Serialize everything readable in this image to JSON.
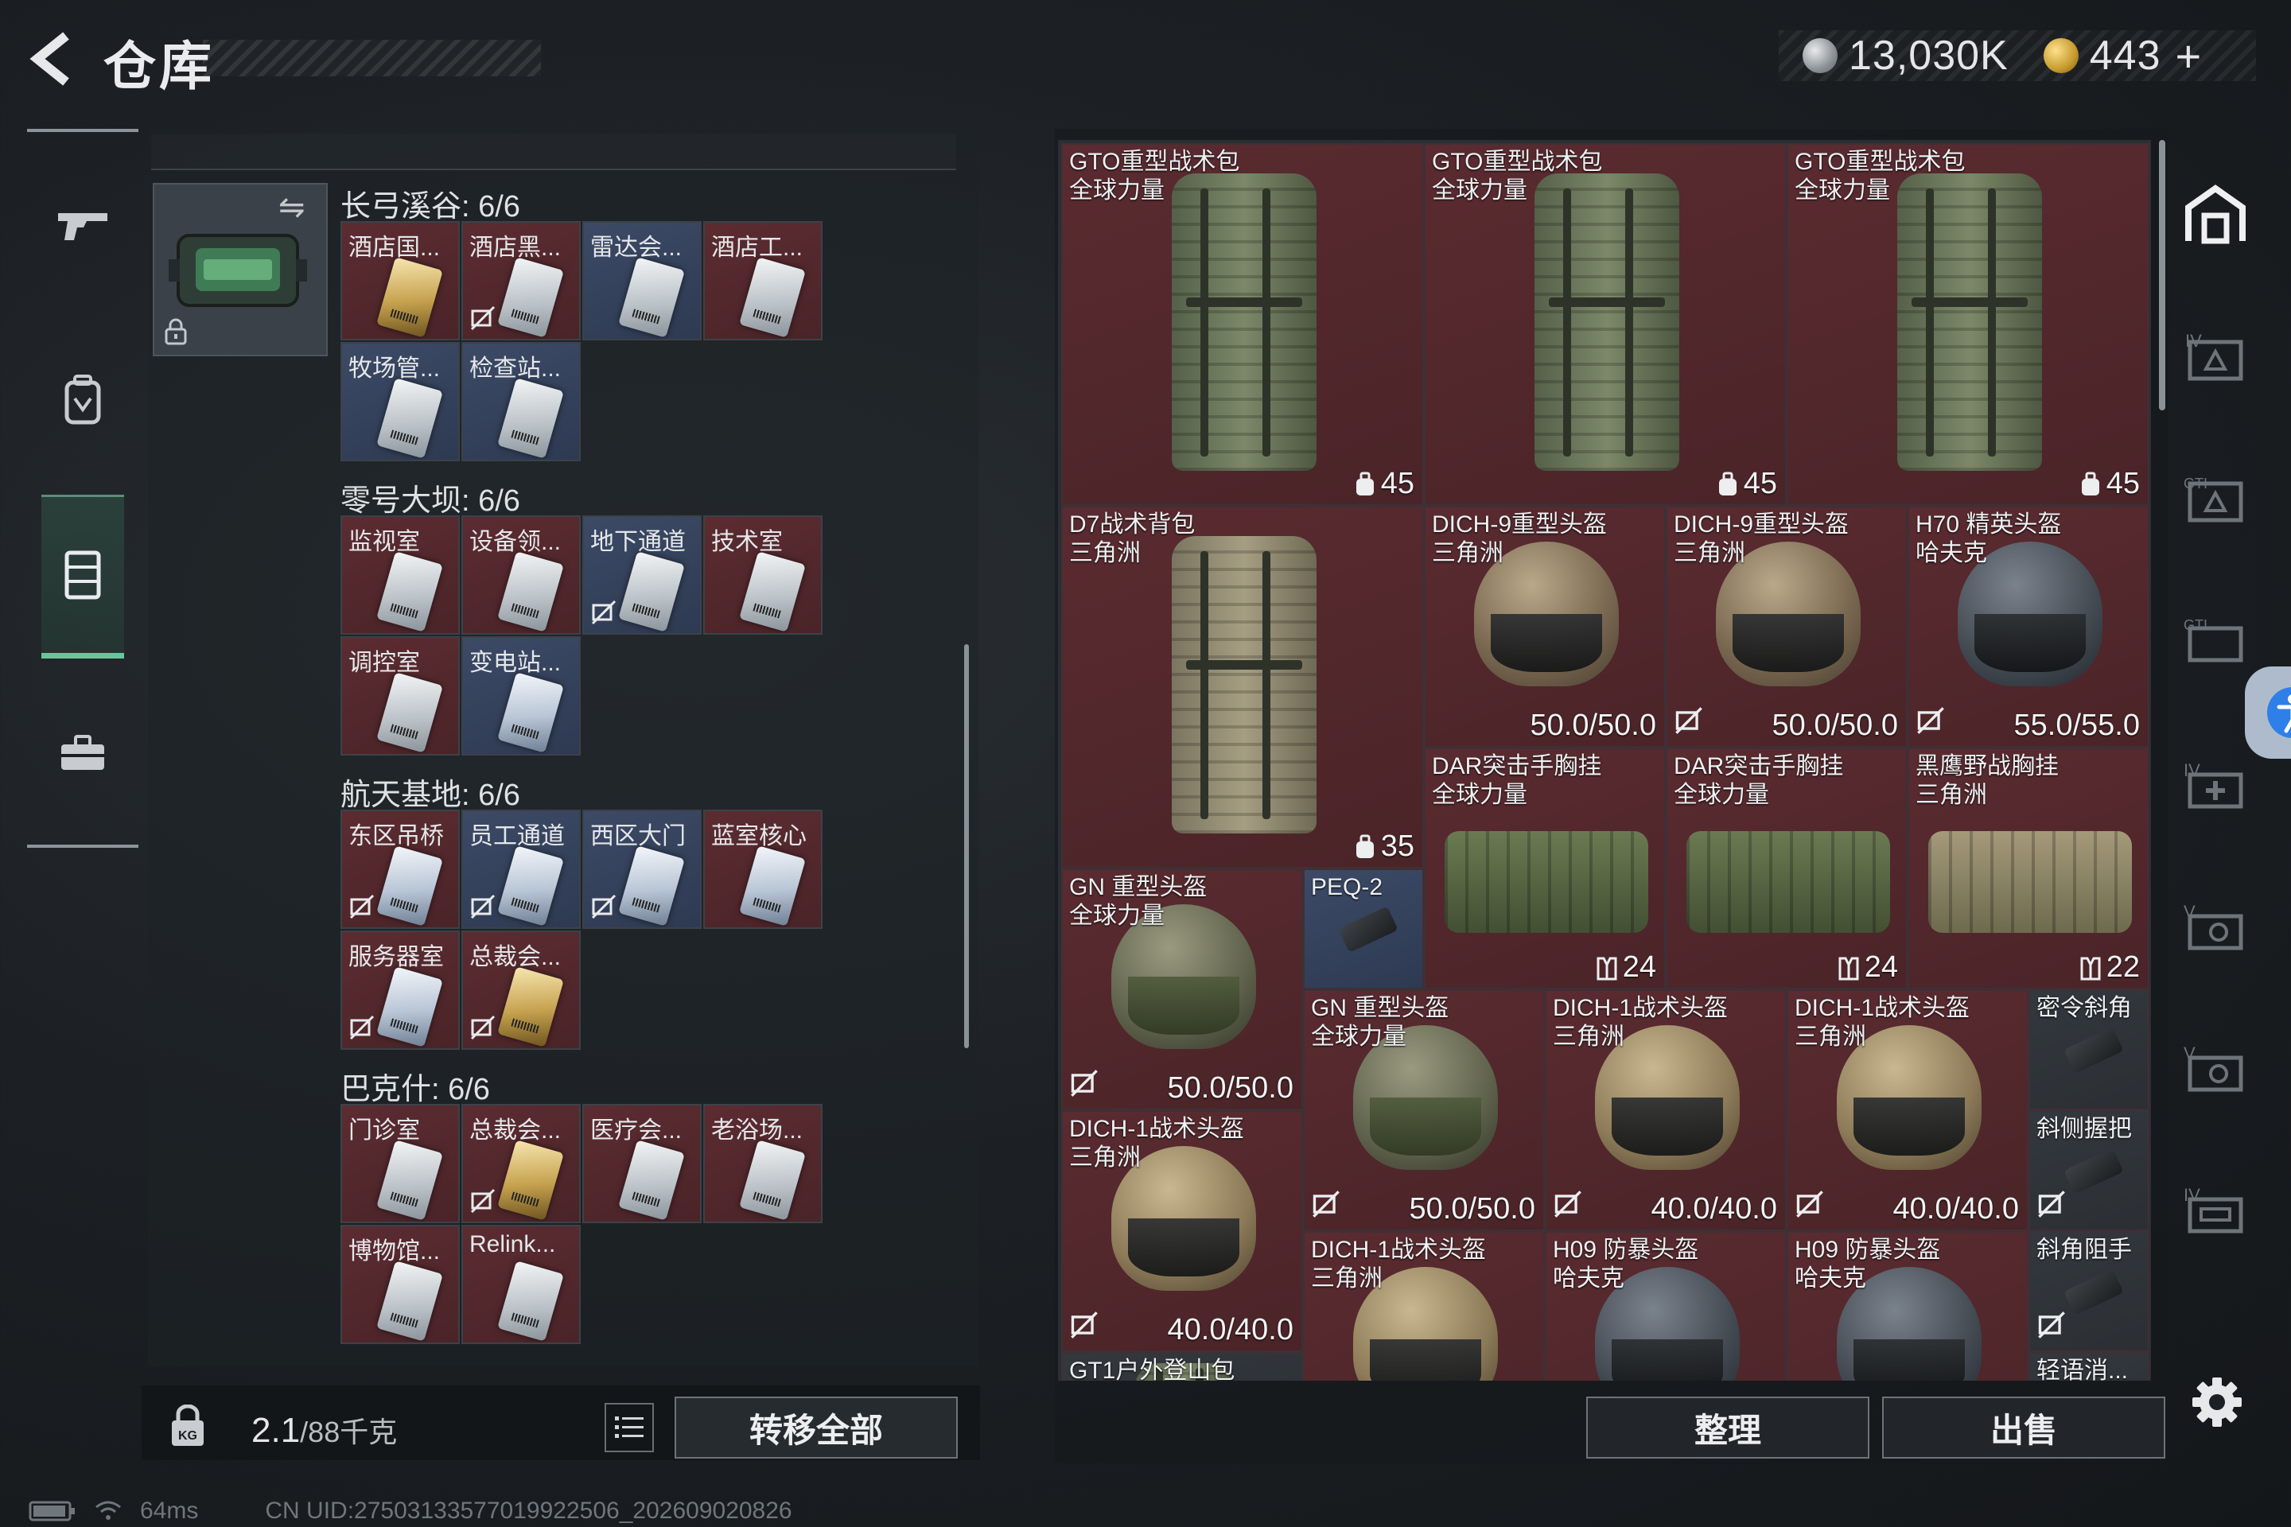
{
  "header": {
    "title": "仓库",
    "silver_amount": "13,030K",
    "gold_amount": "443",
    "plus": "+"
  },
  "nav": {
    "items": [
      {
        "name": "weapons",
        "icon": "rifle-icon"
      },
      {
        "name": "equipment",
        "icon": "backpack-icon"
      },
      {
        "name": "storage",
        "icon": "locker-icon",
        "active": true
      },
      {
        "name": "supplies",
        "icon": "toolbox-icon"
      }
    ]
  },
  "keycards": {
    "sections": [
      {
        "title": "长弓溪谷: 6/6",
        "cards": [
          {
            "label": "酒店国...",
            "tint": "gold",
            "bg": "red",
            "nosell": false
          },
          {
            "label": "酒店黑...",
            "tint": "silver",
            "bg": "red",
            "nosell": true
          },
          {
            "label": "雷达会...",
            "tint": "silver",
            "bg": "blue",
            "nosell": false
          },
          {
            "label": "酒店工...",
            "tint": "silver",
            "bg": "red",
            "nosell": false
          },
          {
            "label": "牧场管...",
            "tint": "silver",
            "bg": "blue",
            "nosell": false
          },
          {
            "label": "检查站...",
            "tint": "silver",
            "bg": "blue",
            "nosell": false
          }
        ]
      },
      {
        "title": "零号大坝: 6/6",
        "cards": [
          {
            "label": "监视室",
            "tint": "silver",
            "bg": "red",
            "nosell": false
          },
          {
            "label": "设备领...",
            "tint": "silver",
            "bg": "red",
            "nosell": false
          },
          {
            "label": "地下通道",
            "tint": "silver",
            "bg": "blue",
            "nosell": true
          },
          {
            "label": "技术室",
            "tint": "silver",
            "bg": "red",
            "nosell": false
          },
          {
            "label": "调控室",
            "tint": "silver",
            "bg": "red",
            "nosell": false
          },
          {
            "label": "变电站...",
            "tint": "blue",
            "bg": "blue",
            "nosell": false
          }
        ]
      },
      {
        "title": "航天基地: 6/6",
        "cards": [
          {
            "label": "东区吊桥",
            "tint": "blue",
            "bg": "red",
            "nosell": true
          },
          {
            "label": "员工通道",
            "tint": "blue",
            "bg": "blue",
            "nosell": true
          },
          {
            "label": "西区大门",
            "tint": "blue",
            "bg": "blue",
            "nosell": true
          },
          {
            "label": "蓝室核心",
            "tint": "blue",
            "bg": "red",
            "nosell": false
          },
          {
            "label": "服务器室",
            "tint": "blue",
            "bg": "red",
            "nosell": true
          },
          {
            "label": "总裁会...",
            "tint": "gold",
            "bg": "red",
            "nosell": true
          }
        ]
      },
      {
        "title": "巴克什: 6/6",
        "cards": [
          {
            "label": "门诊室",
            "tint": "silver",
            "bg": "red",
            "nosell": false
          },
          {
            "label": "总裁会...",
            "tint": "gold",
            "bg": "red",
            "nosell": true
          },
          {
            "label": "医疗会...",
            "tint": "silver",
            "bg": "red",
            "nosell": false
          },
          {
            "label": "老浴场...",
            "tint": "silver",
            "bg": "red",
            "nosell": false
          },
          {
            "label": "博物馆...",
            "tint": "silver",
            "bg": "red",
            "nosell": false
          },
          {
            "label": "Relink...",
            "tint": "silver",
            "bg": "red",
            "nosell": false
          }
        ]
      }
    ]
  },
  "weight": {
    "current": "2.1",
    "max": "/88千克"
  },
  "buttons": {
    "transfer_all": "转移全部",
    "sort": "整理",
    "sell": "出售"
  },
  "stash_items": [
    {
      "name": "GTO重型战术包",
      "sub": "全球力量",
      "value": "45",
      "value_icon": "capacity-icon",
      "kind": "backpack"
    },
    {
      "name": "GTO重型战术包",
      "sub": "全球力量",
      "value": "45",
      "value_icon": "capacity-icon",
      "kind": "backpack"
    },
    {
      "name": "GTO重型战术包",
      "sub": "全球力量",
      "value": "45",
      "value_icon": "capacity-icon",
      "kind": "backpack"
    },
    {
      "name": "D7战术背包",
      "sub": "三角洲",
      "value": "35",
      "value_icon": "capacity-icon",
      "kind": "backpack-tan"
    },
    {
      "name": "DICH-9重型头盔",
      "sub": "三角洲",
      "value": "50.0/50.0",
      "nosell": false,
      "kind": "helmet-camo"
    },
    {
      "name": "DICH-9重型头盔",
      "sub": "三角洲",
      "value": "50.0/50.0",
      "nosell": true,
      "kind": "helmet-camo"
    },
    {
      "name": "H70 精英头盔",
      "sub": "哈夫克",
      "value": "55.0/55.0",
      "nosell": true,
      "kind": "helmet-dark"
    },
    {
      "name": "DAR突击手胸挂",
      "sub": "全球力量",
      "value": "24",
      "value_icon": "vest-icon",
      "kind": "rig"
    },
    {
      "name": "DAR突击手胸挂",
      "sub": "全球力量",
      "value": "24",
      "value_icon": "vest-icon",
      "kind": "rig"
    },
    {
      "name": "黑鹰野战胸挂",
      "sub": "三角洲",
      "value": "22",
      "value_icon": "vest-icon",
      "kind": "rig-tan"
    },
    {
      "name": "GN 重型头盔",
      "sub": "全球力量",
      "value": "50.0/50.0",
      "nosell": true,
      "kind": "helmet-olive"
    },
    {
      "name": "PEQ-2",
      "sub": "",
      "value": "",
      "kind": "part"
    },
    {
      "name": "GN 重型头盔",
      "sub": "全球力量",
      "value": "50.0/50.0",
      "nosell": true,
      "kind": "helmet-olive"
    },
    {
      "name": "DICH-1战术头盔",
      "sub": "三角洲",
      "value": "40.0/40.0",
      "nosell": true,
      "kind": "helmet-tan"
    },
    {
      "name": "DICH-1战术头盔",
      "sub": "三角洲",
      "value": "40.0/40.0",
      "nosell": true,
      "kind": "helmet-tan"
    },
    {
      "name": "密令斜角",
      "sub": "",
      "value": "",
      "nosell": false,
      "kind": "part"
    },
    {
      "name": "DICH-1战术头盔",
      "sub": "三角洲",
      "value": "40.0/40.0",
      "nosell": true,
      "kind": "helmet-tan"
    },
    {
      "name": "斜侧握把",
      "sub": "",
      "value": "",
      "nosell": true,
      "kind": "part"
    },
    {
      "name": "DICH-1战术头盔",
      "sub": "三角洲",
      "value": "",
      "kind": "helmet-tan"
    },
    {
      "name": "H09 防暴头盔",
      "sub": "哈夫克",
      "value": "",
      "kind": "helmet-dark"
    },
    {
      "name": "H09 防暴头盔",
      "sub": "哈夫克",
      "value": "",
      "kind": "helmet-dark"
    },
    {
      "name": "斜角阻手",
      "sub": "",
      "value": "",
      "nosell": true,
      "kind": "part"
    },
    {
      "name": "GT1户外登山包",
      "sub": "",
      "value": "",
      "kind": "backpack"
    },
    {
      "name": "轻语消...",
      "sub": "",
      "value": "",
      "kind": "part"
    }
  ],
  "status": {
    "ping": "64ms",
    "uid": "CN UID:27503133577019922506_202609020826"
  },
  "colors": {
    "accent_green": "#6cc59a",
    "rarity_red": "#5a2b30",
    "rarity_blue": "#3c4a66"
  }
}
